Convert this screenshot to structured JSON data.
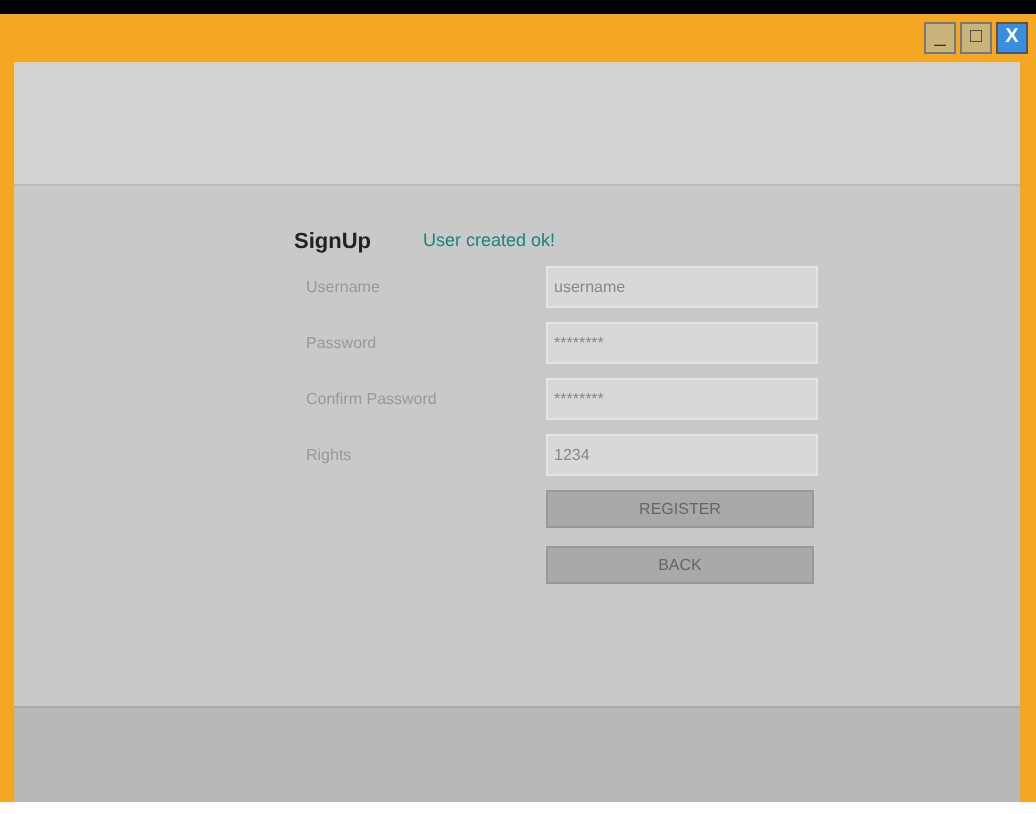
{
  "window": {
    "buttons": [
      "_",
      "□",
      "X"
    ]
  },
  "form": {
    "title": "SignUp",
    "message": "User created ok!",
    "fields": [
      {
        "label": "Username",
        "value": "username"
      },
      {
        "label": "Password",
        "value": "********"
      },
      {
        "label": "Confirm Password",
        "value": "********"
      },
      {
        "label": "Rights",
        "value": "1234"
      }
    ],
    "buttons": [
      "REGISTER",
      "BACK"
    ]
  }
}
